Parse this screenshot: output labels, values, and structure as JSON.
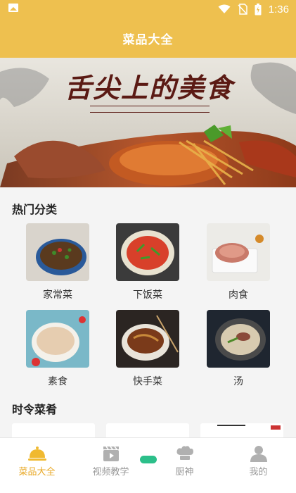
{
  "status_bar": {
    "time": "1:36"
  },
  "header": {
    "title": "菜品大全"
  },
  "banner": {
    "headline": "舌尖上的美食"
  },
  "hot_categories": {
    "title": "热门分类",
    "items": [
      {
        "label": "家常菜"
      },
      {
        "label": "下饭菜"
      },
      {
        "label": "肉食"
      },
      {
        "label": "素食"
      },
      {
        "label": "快手菜"
      },
      {
        "label": "汤"
      }
    ]
  },
  "seasonal": {
    "title": "时令菜肴"
  },
  "tabs": [
    {
      "label": "菜品大全",
      "active": true
    },
    {
      "label": "视频教学",
      "active": false
    },
    {
      "label": "厨神",
      "active": false
    },
    {
      "label": "我的",
      "active": false
    }
  ],
  "colors": {
    "brand": "#eec04f",
    "active_tab": "#e8a825",
    "inactive_tab": "#aaaaaa"
  }
}
